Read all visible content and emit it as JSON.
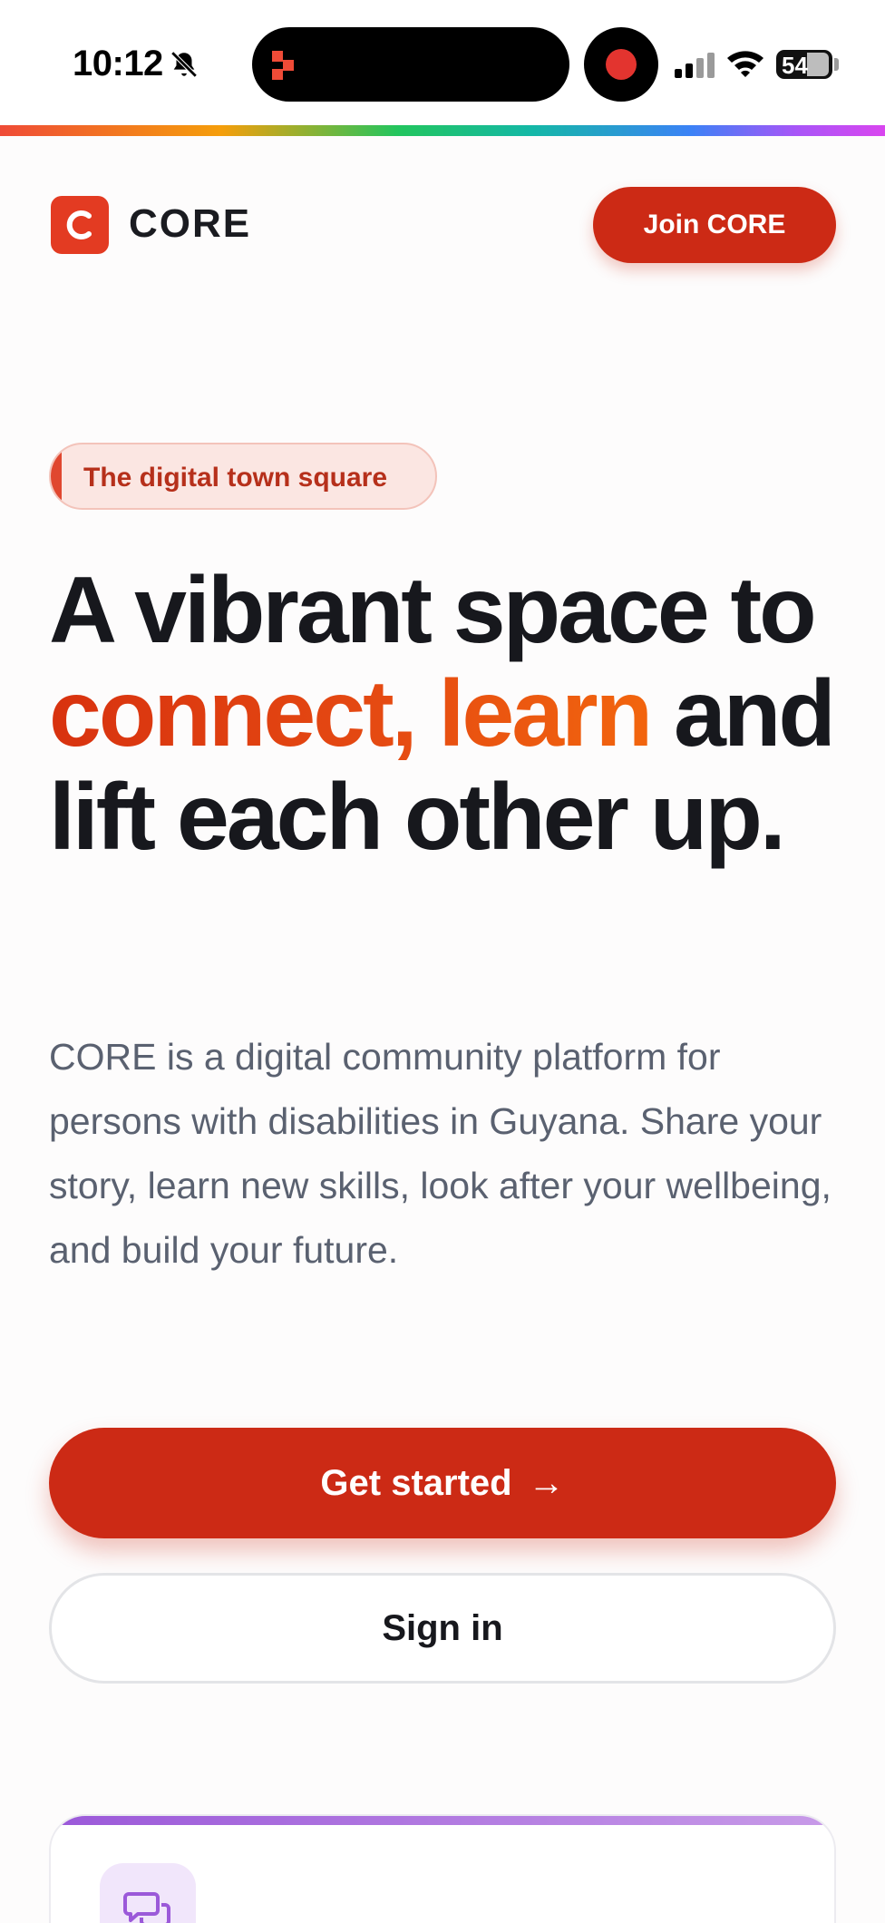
{
  "status_bar": {
    "time": "10:12",
    "battery": "54",
    "icons": [
      "bell-off-icon",
      "app-glyph-icon",
      "recording-icon",
      "signal-icon",
      "wifi-icon",
      "battery-icon"
    ]
  },
  "header": {
    "brand_name": "CORE",
    "join_label": "Join CORE"
  },
  "hero": {
    "eyebrow": "The digital town square",
    "headline_prefix": "A vibrant space to ",
    "headline_accent": "connect, learn",
    "headline_suffix": " and lift each other up.",
    "body": "CORE is a digital community platform for persons with disabilities in Guyana. Share your story, learn new skills, look after your wellbeing, and build your future."
  },
  "actions": {
    "primary_label": "Get started",
    "primary_arrow": "→",
    "secondary_label": "Sign in"
  },
  "colors": {
    "brand": "#cc2a15",
    "accent_gradient_start": "#d8320f",
    "accent_gradient_end": "#f2650e",
    "card_accent": "#9b59d9"
  }
}
